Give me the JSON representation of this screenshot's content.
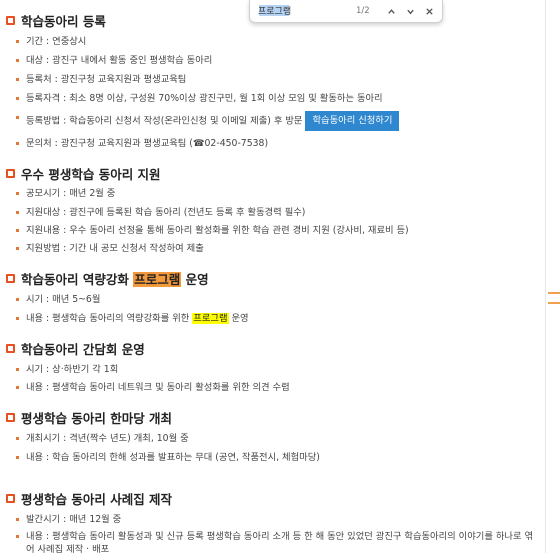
{
  "find_bar": {
    "query": "프로그램",
    "count": "1/2"
  },
  "sections": [
    {
      "title": "학습동아리 등록",
      "items": [
        "기간 : 연중상시",
        "대상 : 광진구 내에서 활동 중인 평생학습 동아리",
        "등록처 : 광진구청 교육지원과 평생교육팀",
        "등록자격 : 최소 8명 이상, 구성원 70%이상 광진구민, 월 1회 이상 모임 및 활동하는 동아리",
        "등록방법 : 학습동아리 신청서 작성(온라인신청 및 이메일 제출) 후 방문",
        "문의처 : 광진구청 교육지원과 평생교육팀 (☎02-450-7538)"
      ],
      "apply_button": "학습동아리 신청하기"
    },
    {
      "title": "우수 평생학습 동아리 지원",
      "items": [
        "공모시기 : 매년 2월 중",
        "지원대상 : 광진구에 등록된 학습 동아리 (전년도 등록 후 활동경력 필수)",
        "지원내용 : 우수 동아리 선정을 통해 동아리 활성화를 위한 학습 관련 경비 지원 (강사비, 재료비 등)",
        "지원방법 : 기간 내 공모 신청서 작성하여 제출"
      ]
    },
    {
      "title_before": "학습동아리 역량강화 ",
      "title_highlight": "프로그램",
      "title_after": " 운영",
      "items": [
        "시기 : 매년 5~6월"
      ],
      "item2_before": "내용 : 평생학습 동아리의 역량강화를 위한 ",
      "item2_highlight": "프로그램",
      "item2_after": " 운영"
    },
    {
      "title": "학습동아리 간담회 운영",
      "items": [
        "시기 : 상·하반기 각 1회",
        "내용 : 평생학습 동아리 네트워크 및 동아리 활성화를 위한 의견 수렴"
      ]
    },
    {
      "title": "평생학습 동아리 한마당 개최",
      "items": [
        "개최시기 : 격년(짝수 년도) 개최, 10월 중",
        "내용 : 학습 동아리의 한해 성과를 발표하는 무대 (공연, 작품전시, 체험마당)"
      ]
    },
    {
      "title": "평생학습 동아리 사례집 제작",
      "items": [
        "발간시기 : 매년 12월 중",
        "내용 : 평생학습 동아리 활동성과 및 신규 등록 평생학습 동아리 소개 등 한 해 동안 있었던 광진구 학습동아리의 이야기를 하나로 엮어 사례집 제작 · 배포"
      ]
    }
  ],
  "colors": {
    "accent": "#e8511f",
    "button": "#2f87cf",
    "highlight_current": "#f59a3c",
    "highlight_other": "#ffff00"
  }
}
